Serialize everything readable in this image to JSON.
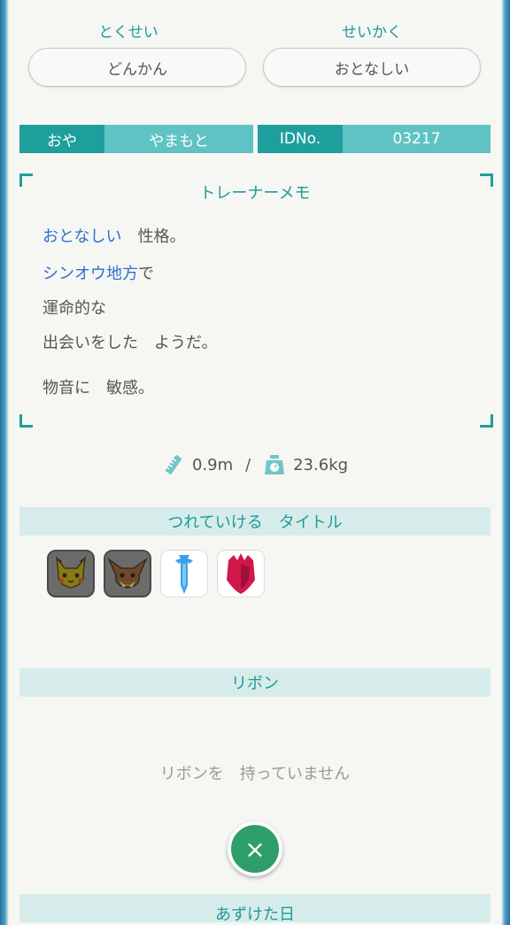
{
  "ability": {
    "label": "とくせい",
    "value": "どんかん"
  },
  "nature": {
    "label": "せいかく",
    "value": "おとなしい"
  },
  "trainer": {
    "ot_label": "おや",
    "ot_value": "やまもと",
    "id_label": "IDNo.",
    "id_value": "03217"
  },
  "memo": {
    "title": "トレーナーメモ",
    "nature_word": "おとなしい",
    "nature_suffix": "性格。",
    "region": "シンオウ地方",
    "region_suffix": "で",
    "line3": "運命的な",
    "line4": "出会いをした　ようだ。",
    "characteristic": "物音に　敏感。"
  },
  "measurements": {
    "height": "0.9m",
    "separator": "/",
    "weight": "23.6kg"
  },
  "titles_section": {
    "heading": "つれていける　タイトル",
    "icons": [
      "pikachu-badge-icon",
      "eevee-badge-icon",
      "sword-badge-icon",
      "shield-badge-icon"
    ]
  },
  "ribbons_section": {
    "heading": "リボン",
    "empty_text": "リボンを　持っていません"
  },
  "close_button": {
    "symbol": "×"
  },
  "next_section": {
    "heading": "あずけた日"
  },
  "colors": {
    "accent": "#1f9e9e",
    "accent_light": "#5fc3c3",
    "link_blue": "#2f6fd6",
    "close_green": "#2e9e6a"
  }
}
